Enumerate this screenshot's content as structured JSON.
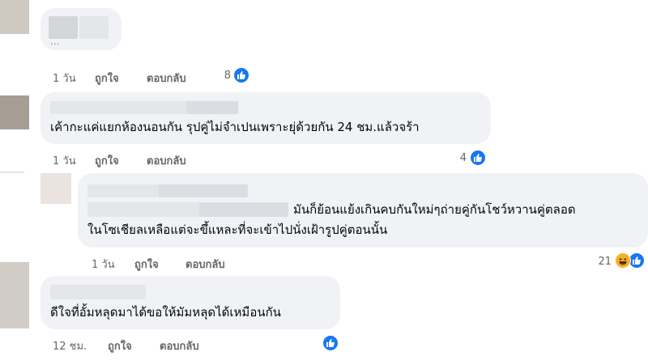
{
  "comments": [
    {
      "name": "",
      "text": "...",
      "time": "1 วัน",
      "like_label": "ถูกใจ",
      "reply_label": "ตอบกลับ",
      "reaction_count": "8"
    },
    {
      "name": "",
      "text": "เค้ากะแค่แยกห้องนอนกัน รุปคู่ไม่จำเปนเพราะยุ่ด้วยกัน 24 ชม.แล้วจร้า",
      "time": "1 วัน",
      "like_label": "ถูกใจ",
      "reply_label": "ตอบกลับ",
      "reaction_count": "4"
    },
    {
      "name": "",
      "text_line1": "มันก็ย้อนแย้งเกินคบกันใหม่ๆถ่ายคู่กันโชว์หวานคู่ตลอด",
      "text_line2": "ในโซเชียลเหลือแต่จะขึ้แหละที่จะเข้าไปนั่งเฝ้ารูปคู่ตอนนั้น",
      "time": "1 วัน",
      "like_label": "ถูกใจ",
      "reply_label": "ตอบกลับ",
      "reaction_count": "21"
    },
    {
      "name": "",
      "text": "ดีใจที่อั้มหลุดมาได้ขอให้มัมหลุดได้เหมือนกัน",
      "time": "12 ชม.",
      "like_label": "ถูกใจ",
      "reply_label": "ตอบกลับ",
      "reaction_count": ""
    }
  ],
  "colors": {
    "bubble": "#f0f2f5",
    "meta": "#65676b",
    "like_blue": "#1877f2",
    "haha_yellow": "#f7b125"
  }
}
